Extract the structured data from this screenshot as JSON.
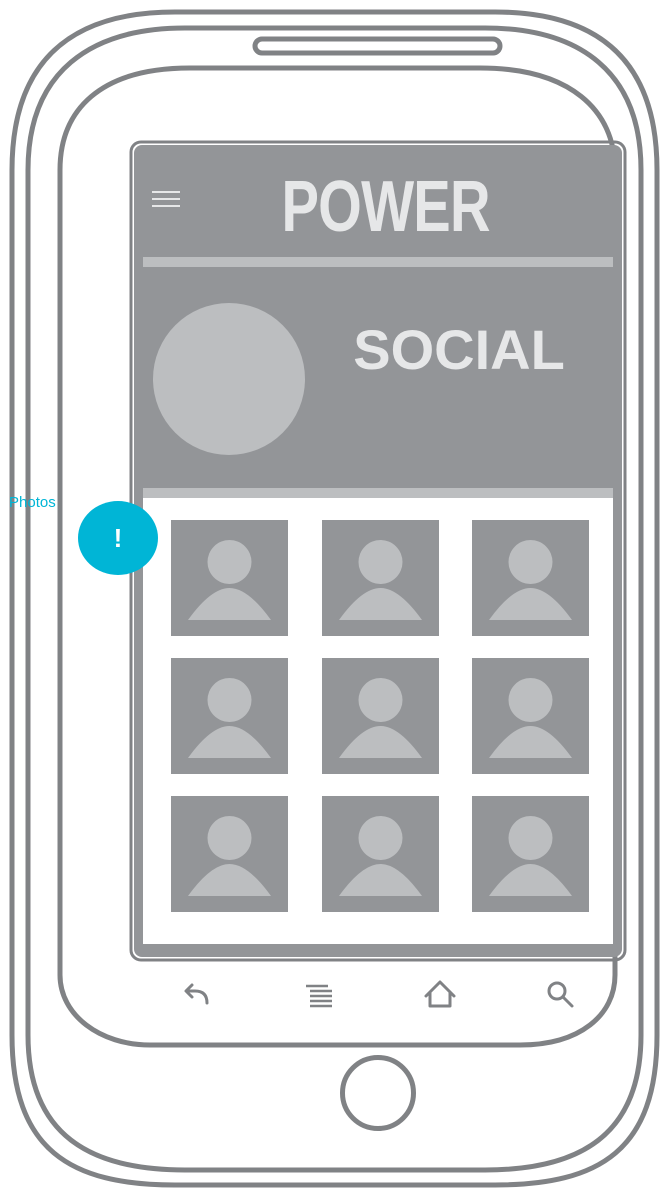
{
  "app": {
    "title": "POWER",
    "menu_icon": "hamburger-menu-icon"
  },
  "profile": {
    "name": "SOCIAL",
    "avatar_icon": "profile-avatar"
  },
  "photos": {
    "count": 9,
    "thumbnail_icon": "person-placeholder-icon"
  },
  "system_nav": {
    "buttons": [
      "back-icon",
      "menu-list-icon",
      "home-icon",
      "search-icon"
    ]
  },
  "annotation": {
    "label": "Photos",
    "marker": "!",
    "color": "#00b5d6"
  },
  "colors": {
    "screen": "#939598",
    "light_gray": "#bcbec0",
    "text_light": "#e6e7e8",
    "outline": "#808285",
    "accent": "#00b5d6"
  }
}
